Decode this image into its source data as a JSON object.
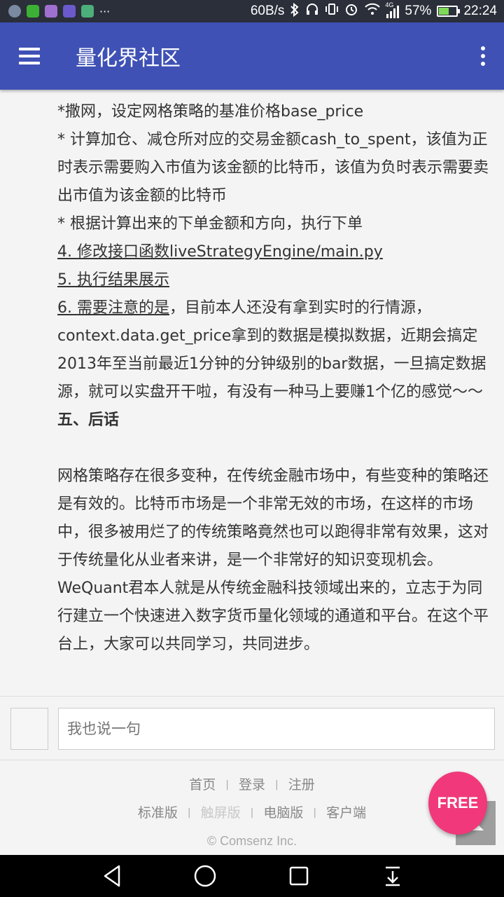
{
  "status_bar": {
    "net_speed": "60B/s",
    "signal_label": "4G",
    "battery": "57%",
    "battery_level": 0.57,
    "time": "22:24",
    "icons": [
      "app-icon",
      "wechat-icon",
      "app-icon",
      "video-icon",
      "app-icon",
      "more-notifications-icon",
      "bluetooth-icon",
      "headphones-icon",
      "vibrate-icon",
      "alarm-icon",
      "wifi-icon",
      "signal-icon",
      "battery-icon"
    ]
  },
  "app_bar": {
    "title": "量化界社区",
    "icons": [
      "menu-icon",
      "more-vert-icon"
    ]
  },
  "article": {
    "lines": [
      "*撒网，设定网格策略的基准价格base_price",
      "* 计算加仓、减仓所对应的交易金额cash_to_spent，该值为正时表示需要购入市值为该金额的比特币，该值为负时表示需要卖出市值为该金额的比特币",
      "* 根据计算出来的下单金额和方向，执行下单"
    ],
    "step4": "4. 修改接口函数liveStrategyEngine/main.py",
    "step5": "5. 执行结果展示",
    "step6_link": "6. 需要注意的是",
    "step6_rest": "，目前本人还没有拿到实时的行情源，context.data.get_price拿到的数据是模拟数据，近期会搞定2013年至当前最近1分钟的分钟级别的bar数据，一旦搞定数据源，就可以实盘开干啦，有没有一种马上要赚1个亿的感觉～～",
    "heading": "五、后话",
    "closing": "网格策略存在很多变种，在传统金融市场中，有些变种的策略还是有效的。比特币市场是一个非常无效的市场，在这样的市场中，很多被用烂了的传统策略竟然也可以跑得非常有效果，这对于传统量化从业者来讲，是一个非常好的知识变现机会。WeQuant君本人就是从传统金融科技领域出来的，立志于为同行建立一个快速进入数字货币量化领域的通道和平台。在这个平台上，大家可以共同学习，共同进步。"
  },
  "comment": {
    "placeholder": "我也说一句"
  },
  "footer": {
    "row1": [
      "首页",
      "登录",
      "注册"
    ],
    "row2": [
      "标准版",
      "触屏版",
      "电脑版",
      "客户端"
    ],
    "separator": "|",
    "copyright": "© Comsenz Inc."
  },
  "floating": {
    "free_label": "FREE"
  },
  "nav_bar": {
    "icons": [
      "back-icon",
      "home-icon",
      "recents-icon",
      "notification-pull-icon"
    ]
  },
  "colors": {
    "app_bar": "#3f51b5",
    "free_button": "#f0387a",
    "status_bar": "#2b2f3a"
  }
}
